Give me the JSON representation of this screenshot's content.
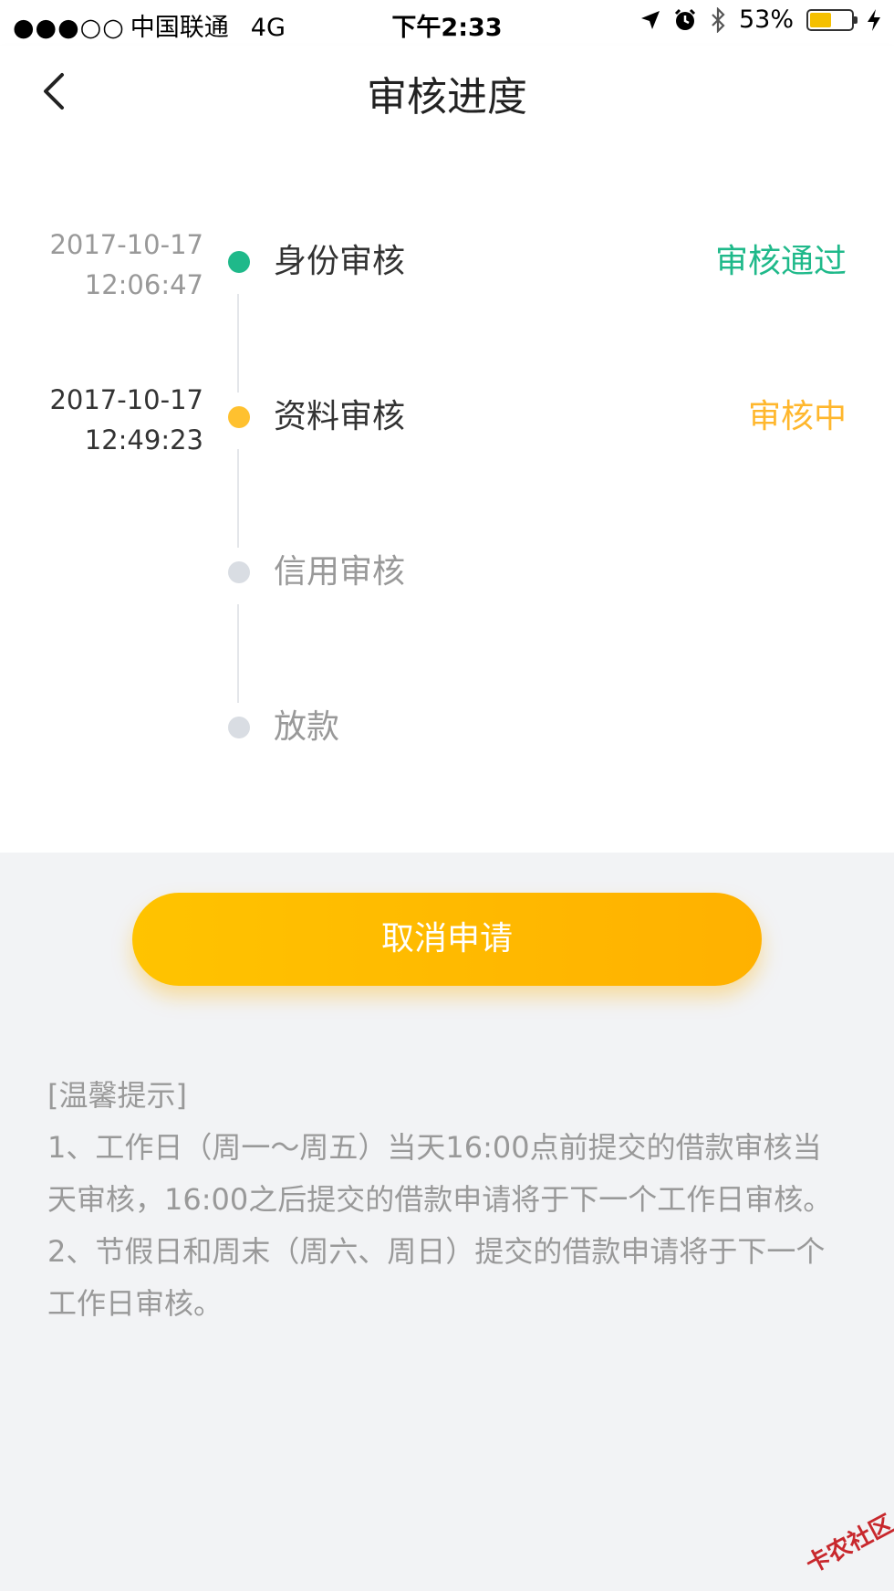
{
  "status_bar": {
    "signal": "●●●○○",
    "carrier": "中国联通",
    "network": "4G",
    "time": "下午2:33",
    "battery": "53%",
    "battery_level": 0.53
  },
  "nav": {
    "title": "审核进度"
  },
  "timeline": [
    {
      "date": "2017-10-17",
      "time": "12:06:47",
      "step": "身份审核",
      "status": "审核通过"
    },
    {
      "date": "2017-10-17",
      "time": "12:49:23",
      "step": "资料审核",
      "status": "审核中"
    },
    {
      "date": "",
      "time": "",
      "step": "信用审核",
      "status": ""
    },
    {
      "date": "",
      "time": "",
      "step": "放款",
      "status": ""
    }
  ],
  "cancel_label": "取消申请",
  "tips": {
    "heading": "[温馨提示]",
    "line1": "1、工作日（周一～周五）当天16:00点前提交的借款审核当天审核，16:00之后提交的借款申请将于下一个工作日审核。",
    "line2": "2、节假日和周末（周六、周日）提交的借款申请将于下一个工作日审核。"
  },
  "watermark": "卡农社区",
  "colors": {
    "passed": "#1fb98a",
    "pending": "#ffb72d",
    "inactive_dot": "#d9dde3",
    "button": "#ffb800"
  }
}
